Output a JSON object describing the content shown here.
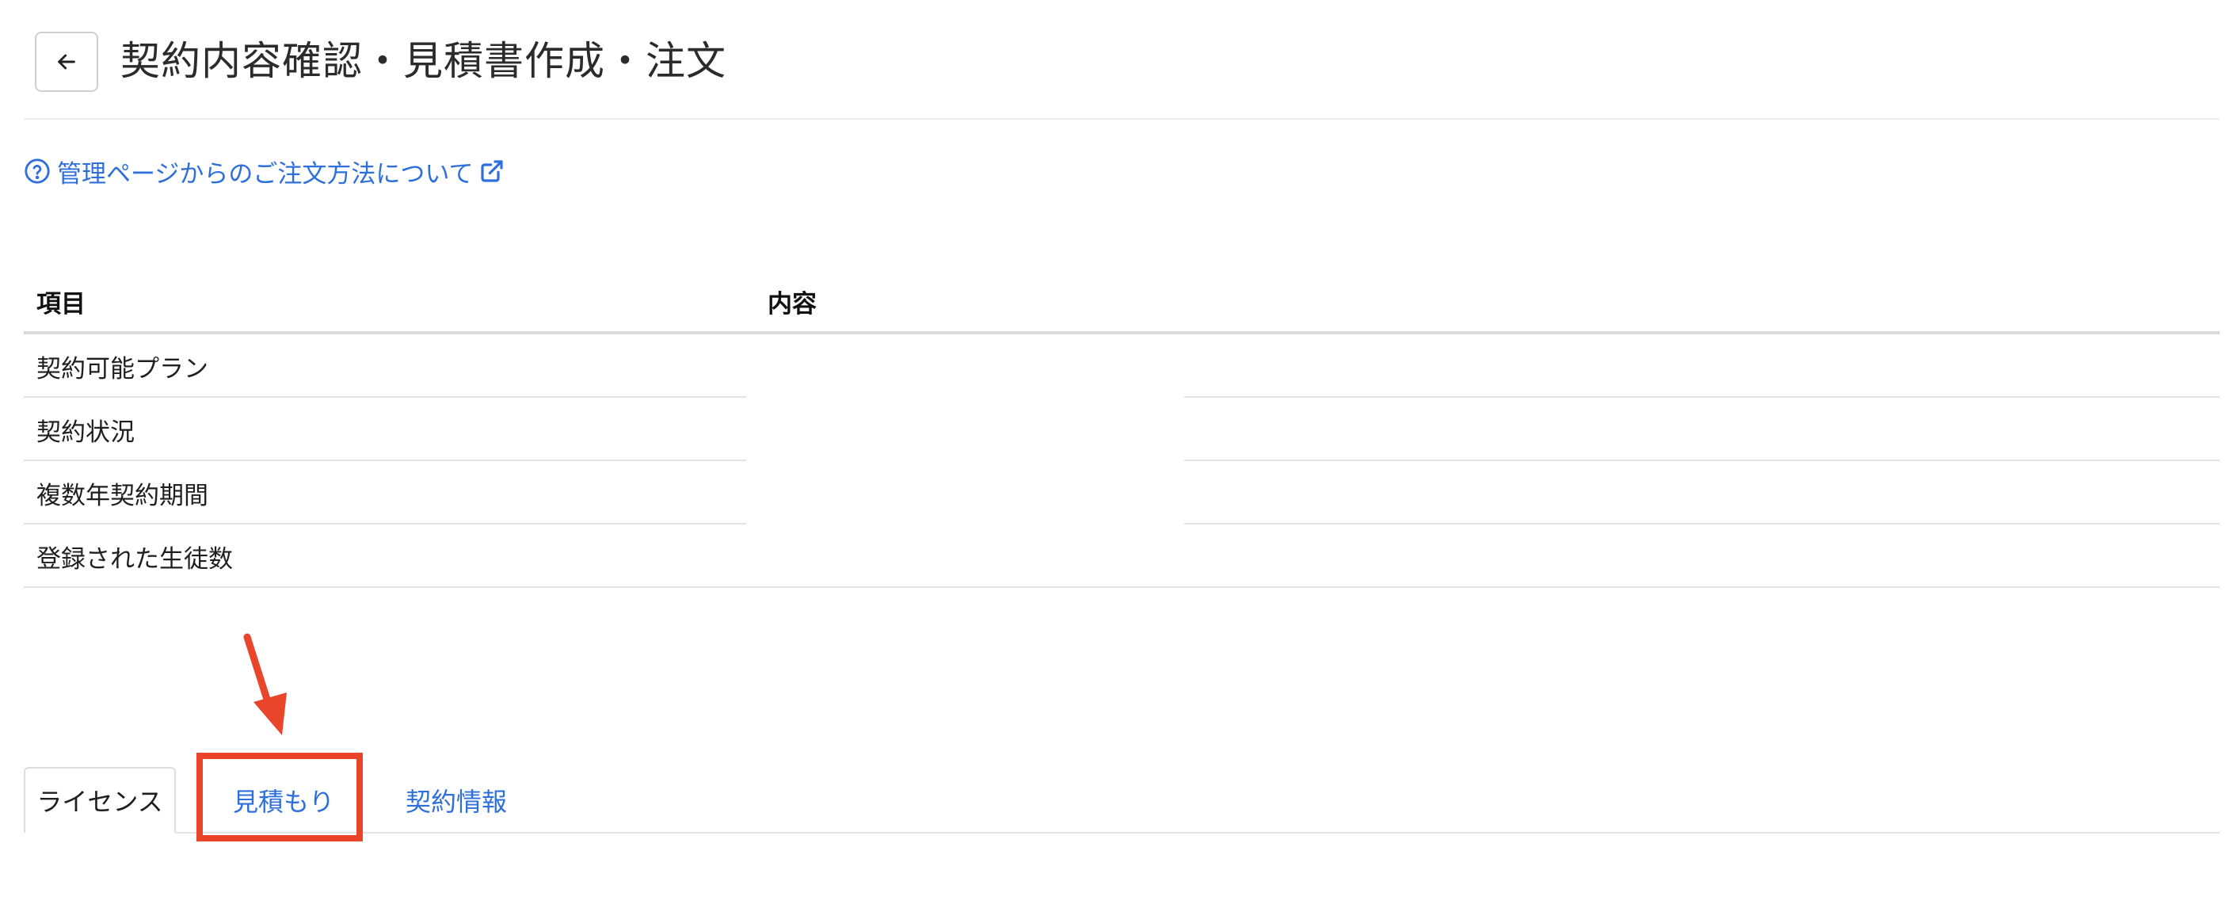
{
  "header": {
    "title": "契約内容確認・見積書作成・注文",
    "back_icon": "arrow-left-icon"
  },
  "help_link": {
    "label": "管理ページからのご注文方法について",
    "icon": "question-circle-icon",
    "external_icon": "external-link-icon"
  },
  "table": {
    "headers": {
      "item": "項目",
      "content": "内容"
    },
    "rows": [
      {
        "label": "契約可能プラン",
        "value": ""
      },
      {
        "label": "契約状況",
        "value": ""
      },
      {
        "label": "複数年契約期間",
        "value": ""
      },
      {
        "label": "登録された生徒数",
        "value": ""
      }
    ]
  },
  "tabs": [
    {
      "label": "ライセンス",
      "active": true
    },
    {
      "label": "見積もり",
      "active": false,
      "highlighted": true
    },
    {
      "label": "契約情報",
      "active": false
    }
  ],
  "colors": {
    "link": "#2f6fdc",
    "annotation": "#e8452a",
    "divider": "#e3e3e3"
  }
}
